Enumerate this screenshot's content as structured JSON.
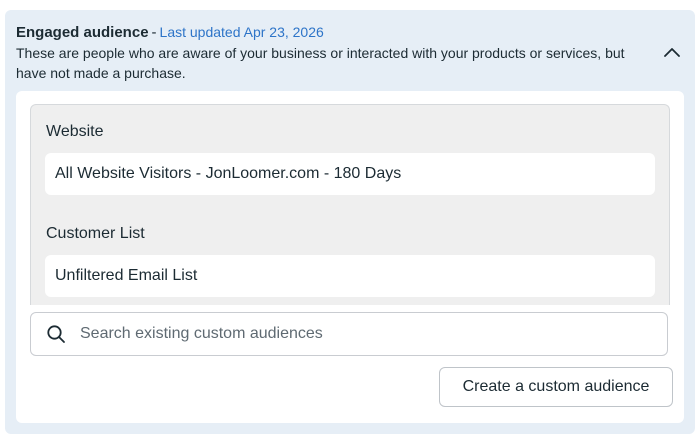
{
  "header": {
    "title": "Engaged audience",
    "separator": "-",
    "last_updated": "Last updated Apr 23, 2026",
    "description": "These are people who are aware of your business or interacted with your products or services, but have not made a purchase.",
    "collapse_icon": "chevron-up-icon"
  },
  "sections": [
    {
      "label": "Website",
      "item": "All Website Visitors - JonLoomer.com - 180 Days"
    },
    {
      "label": "Customer List",
      "item": "Unfiltered Email List"
    }
  ],
  "search": {
    "icon": "search-icon",
    "placeholder": "Search existing custom audiences",
    "value": ""
  },
  "actions": {
    "create_label": "Create a custom audience"
  },
  "colors": {
    "panel_bg": "#e6eef6",
    "accent_link": "#2d74c8",
    "group_bg": "#efefef",
    "text": "#1c2b33"
  }
}
